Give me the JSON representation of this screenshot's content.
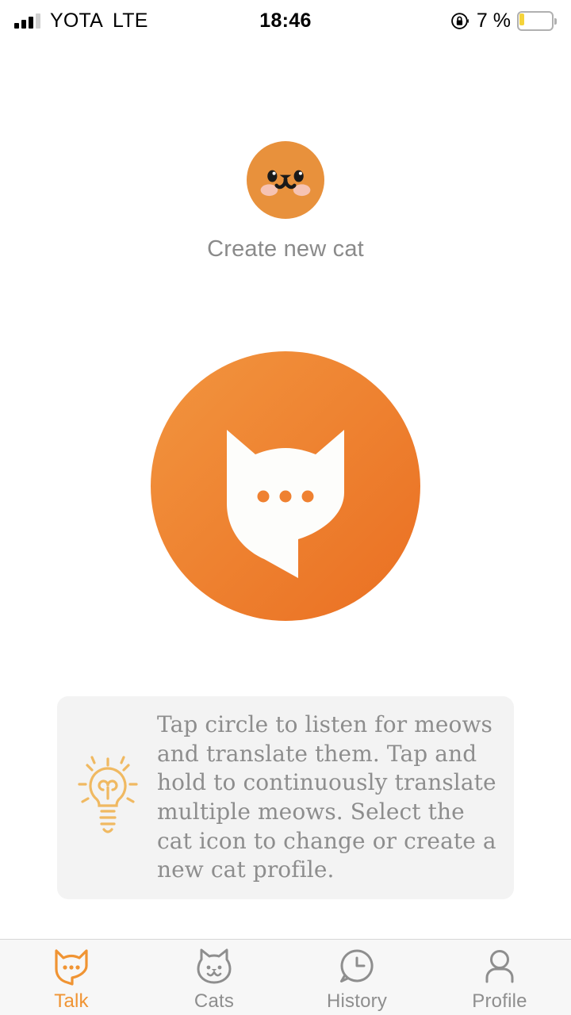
{
  "status_bar": {
    "carrier": "YOTA",
    "network": "LTE",
    "time": "18:46",
    "battery_percent": "7 %",
    "signal_bars_filled": 3,
    "signal_bars_total": 4,
    "rotation_lock_icon": "rotation-lock-icon",
    "battery_icon": "battery-low-icon",
    "battery_color": "#f5d33a"
  },
  "create_cat": {
    "label": "Create new cat",
    "avatar_icon": "cat-face-avatar-icon",
    "avatar_color": "#e8913c",
    "blush_color": "#f6c3b3",
    "label_color": "#8a8a8a"
  },
  "listen": {
    "button_icon": "cat-speech-bubble-icon",
    "gradient_start": "#f2953f",
    "gradient_end": "#ec7024",
    "bubble_color": "#fdfdfb",
    "dots": 3
  },
  "hint": {
    "icon": "lightbulb-icon",
    "icon_color": "#f0b961",
    "background": "#f3f3f3",
    "text_color": "#8d8d8d",
    "text": "Tap circle to listen for meows and translate them.  Tap and hold to continuously translate multiple meows.  Select the cat icon to change or create a new cat profile."
  },
  "tab_bar": {
    "active_color": "#f09433",
    "inactive_color": "#8e8e8e",
    "background": "#f7f7f7",
    "items": [
      {
        "label": "Talk",
        "icon": "cat-speech-bubble-icon",
        "active": true
      },
      {
        "label": "Cats",
        "icon": "cat-face-icon",
        "active": false
      },
      {
        "label": "History",
        "icon": "clock-bubble-icon",
        "active": false
      },
      {
        "label": "Profile",
        "icon": "person-icon",
        "active": false
      }
    ]
  }
}
